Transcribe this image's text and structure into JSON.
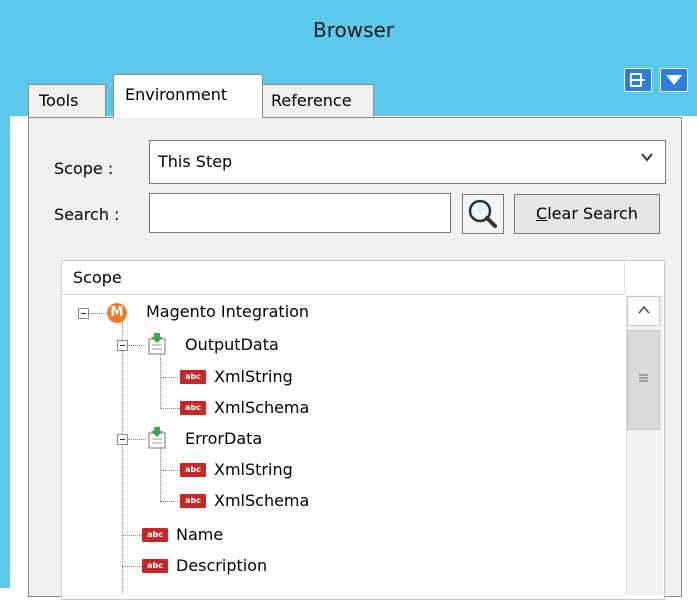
{
  "window": {
    "title": "Browser"
  },
  "tabs": [
    {
      "label": "Tools",
      "active": false
    },
    {
      "label": "Environment",
      "active": true
    },
    {
      "label": "Reference",
      "active": false
    }
  ],
  "title_buttons": {
    "dock_icon": "dock-icon",
    "menu_icon": "dropdown-triangle-icon"
  },
  "scope": {
    "label": "Scope :",
    "value": "This Step"
  },
  "search": {
    "label": "Search :",
    "value": "",
    "clear_label_first": "C",
    "clear_label_rest": "lear Search"
  },
  "tree": {
    "header": "Scope",
    "nodes": [
      {
        "label": "Magento Integration",
        "icon": "magento-icon",
        "level": 0
      },
      {
        "label": "OutputData",
        "icon": "data-object-icon",
        "level": 1
      },
      {
        "label": "XmlString",
        "icon": "string-icon",
        "level": 2
      },
      {
        "label": "XmlSchema",
        "icon": "string-icon",
        "level": 2
      },
      {
        "label": "ErrorData",
        "icon": "data-object-icon",
        "level": 1
      },
      {
        "label": "XmlString",
        "icon": "string-icon",
        "level": 2
      },
      {
        "label": "XmlSchema",
        "icon": "string-icon",
        "level": 2
      },
      {
        "label": "Name",
        "icon": "string-icon",
        "level": 1
      },
      {
        "label": "Description",
        "icon": "string-icon",
        "level": 1
      }
    ],
    "icon_text": "abc"
  },
  "colors": {
    "titlebar": "#5ec8ea",
    "accent_button": "#2a7fe0",
    "string_icon": "#c62828",
    "magento_icon": "#f07c2a",
    "data_icon_arrow": "#3aa845"
  }
}
